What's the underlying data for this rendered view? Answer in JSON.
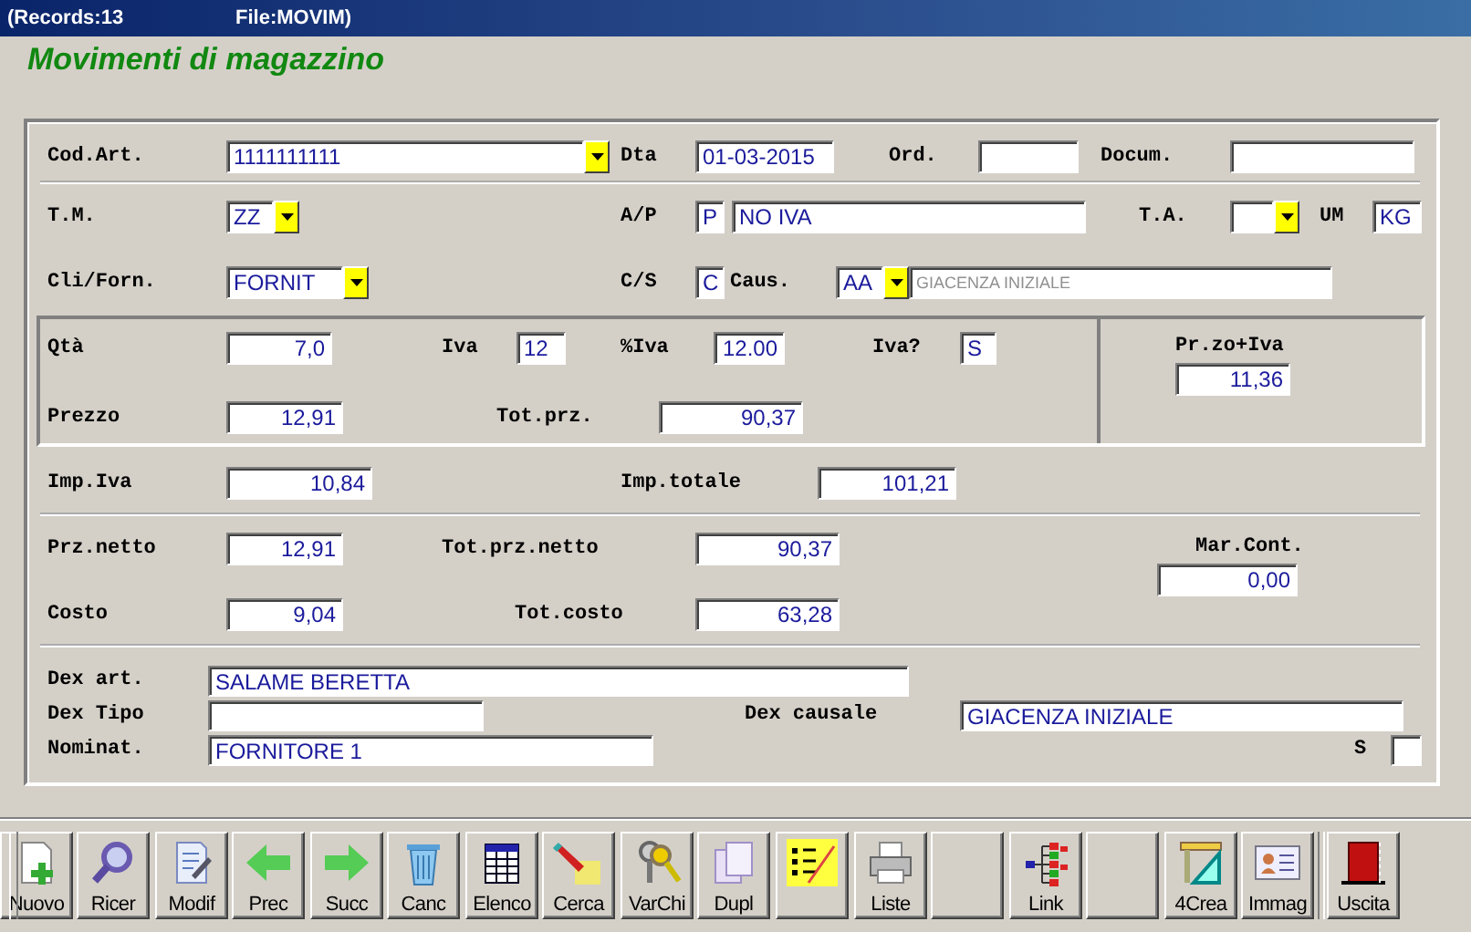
{
  "title_bar": {
    "records": "(Records:13",
    "file": "File:MOVIM)"
  },
  "heading": "Movimenti di magazzino",
  "sections": [
    {
      "rows": [
        {
          "items": [
            {
              "kind": "label",
              "text": "Cod.Art."
            },
            {
              "kind": "combo",
              "value": "1111111111"
            },
            {
              "kind": "label",
              "text": "Dta"
            },
            {
              "kind": "text",
              "value": "01-03-2015"
            },
            {
              "kind": "label",
              "text": "Ord."
            },
            {
              "kind": "text",
              "value": ""
            },
            {
              "kind": "label",
              "text": "Docum."
            },
            {
              "kind": "text",
              "value": ""
            }
          ]
        }
      ]
    },
    {
      "rows": [
        {
          "items": [
            {
              "kind": "label",
              "text": "T.M."
            },
            {
              "kind": "combo",
              "value": "ZZ"
            },
            {
              "kind": "label",
              "text": "A/P"
            },
            {
              "kind": "text",
              "value": "P"
            },
            {
              "kind": "text",
              "value": "NO IVA"
            },
            {
              "kind": "label",
              "text": "T.A."
            },
            {
              "kind": "combo",
              "value": ""
            },
            {
              "kind": "label",
              "text": "UM"
            },
            {
              "kind": "text",
              "value": "KG"
            }
          ]
        },
        {
          "items": [
            {
              "kind": "label",
              "text": "Cli/Forn."
            },
            {
              "kind": "combo",
              "value": "FORNIT"
            },
            {
              "kind": "label",
              "text": "C/S"
            },
            {
              "kind": "text",
              "value": "C"
            },
            {
              "kind": "label",
              "text": "Caus."
            },
            {
              "kind": "combo",
              "value": "AA"
            },
            {
              "kind": "readonly",
              "value": "GIACENZA INIZIALE"
            }
          ]
        }
      ]
    },
    {
      "rows": [
        {
          "items": [
            {
              "kind": "label",
              "text": "Qtà"
            },
            {
              "kind": "number",
              "value": "7,0"
            },
            {
              "kind": "label",
              "text": "Iva"
            },
            {
              "kind": "text",
              "value": "12"
            },
            {
              "kind": "label",
              "text": "%Iva"
            },
            {
              "kind": "number",
              "value": "12.00"
            },
            {
              "kind": "label",
              "text": "Iva?"
            },
            {
              "kind": "text",
              "value": "S"
            }
          ]
        },
        {
          "items": [
            {
              "kind": "label",
              "text": "Prezzo"
            },
            {
              "kind": "number",
              "value": "12,91"
            },
            {
              "kind": "label",
              "text": "Tot.prz."
            },
            {
              "kind": "number",
              "value": "90,37"
            }
          ]
        }
      ],
      "side": {
        "label": "Pr.zo+Iva",
        "value": "11,36"
      }
    },
    {
      "rows": [
        {
          "items": [
            {
              "kind": "label",
              "text": "Imp.Iva"
            },
            {
              "kind": "number",
              "value": "10,84"
            },
            {
              "kind": "label",
              "text": "Imp.totale"
            },
            {
              "kind": "number",
              "value": "101,21"
            }
          ]
        }
      ]
    },
    {
      "rows": [
        {
          "items": [
            {
              "kind": "label",
              "text": "Prz.netto"
            },
            {
              "kind": "number",
              "value": "12,91"
            },
            {
              "kind": "label",
              "text": "Tot.prz.netto"
            },
            {
              "kind": "number",
              "value": "90,37"
            }
          ]
        },
        {
          "items": [
            {
              "kind": "label",
              "text": "Costo"
            },
            {
              "kind": "number",
              "value": "9,04"
            },
            {
              "kind": "label",
              "text": "Tot.costo"
            },
            {
              "kind": "number",
              "value": "63,28"
            }
          ]
        }
      ],
      "side": {
        "label": "Mar.Cont.",
        "value": "0,00"
      }
    },
    {
      "rows": [
        {
          "items": [
            {
              "kind": "label",
              "text": "Dex art."
            },
            {
              "kind": "text",
              "value": "SALAME BERETTA"
            }
          ]
        },
        {
          "items": [
            {
              "kind": "label",
              "text": "Dex Tipo"
            },
            {
              "kind": "text",
              "value": ""
            },
            {
              "kind": "label",
              "text": "Dex causale"
            },
            {
              "kind": "text",
              "value": "GIACENZA INIZIALE"
            }
          ]
        },
        {
          "items": [
            {
              "kind": "label",
              "text": "Nominat."
            },
            {
              "kind": "text",
              "value": "FORNITORE 1"
            },
            {
              "kind": "label",
              "text": "S"
            },
            {
              "kind": "checkbox",
              "checked": false
            }
          ]
        }
      ]
    }
  ],
  "toolbar": [
    {
      "kind": "labeled",
      "label": "Nuovo"
    },
    {
      "kind": "labeled",
      "label": "Ricer"
    },
    {
      "kind": "labeled",
      "label": "Modif"
    },
    {
      "kind": "labeled",
      "label": "Prec"
    },
    {
      "kind": "labeled",
      "label": "Succ"
    },
    {
      "kind": "labeled",
      "label": "Canc"
    },
    {
      "kind": "labeled",
      "label": "Elenco"
    },
    {
      "kind": "labeled",
      "label": "Cerca"
    },
    {
      "kind": "labeled",
      "label": "VarChi"
    },
    {
      "kind": "labeled",
      "label": "Dupl"
    },
    {
      "kind": "icon-only"
    },
    {
      "kind": "labeled",
      "label": "Liste"
    },
    {
      "kind": "blank"
    },
    {
      "kind": "labeled",
      "label": "Link"
    },
    {
      "kind": "blank"
    },
    {
      "kind": "labeled",
      "label": "4Crea"
    },
    {
      "kind": "labeled",
      "label": "Immag"
    },
    {
      "kind": "labeled",
      "label": "Uscita"
    }
  ]
}
